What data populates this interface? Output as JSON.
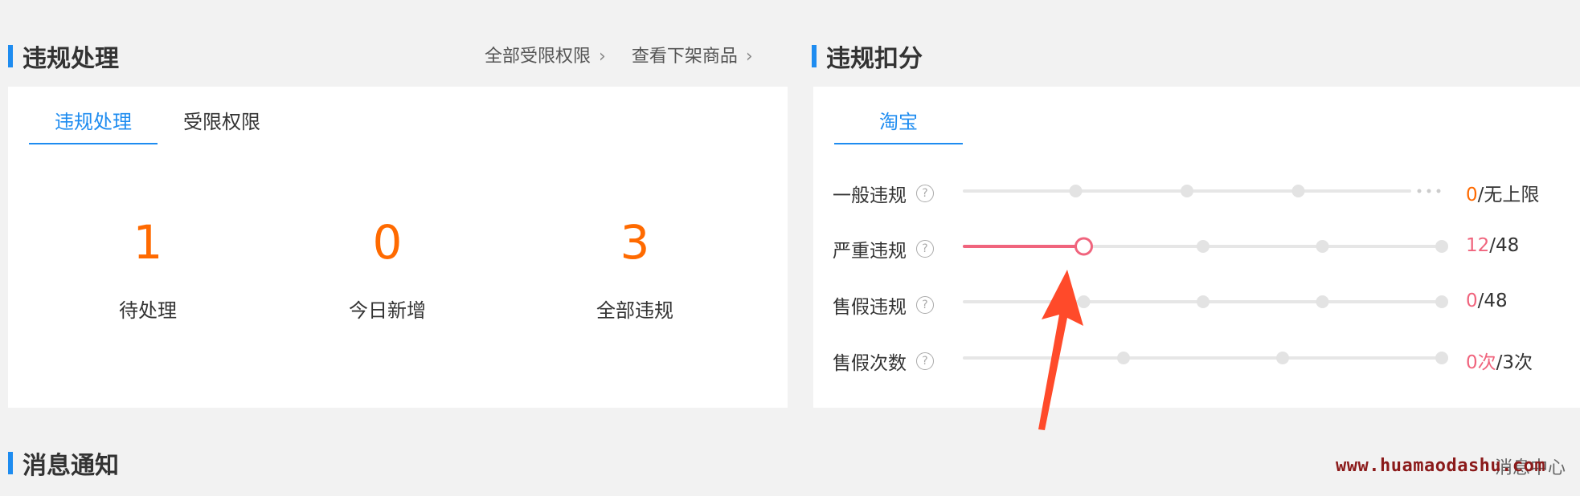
{
  "violation_section": {
    "title": "违规处理",
    "links": [
      "全部受限权限",
      "查看下架商品"
    ],
    "tabs": [
      {
        "label": "违规处理",
        "active": true
      },
      {
        "label": "受限权限",
        "active": false
      }
    ],
    "stats": [
      {
        "value": "1",
        "label": "待处理"
      },
      {
        "value": "0",
        "label": "今日新增"
      },
      {
        "value": "3",
        "label": "全部违规"
      }
    ]
  },
  "deduction_section": {
    "title": "违规扣分",
    "tabs": [
      {
        "label": "淘宝",
        "active": true
      }
    ],
    "rows": [
      {
        "label": "一般违规",
        "current": "0",
        "sep": "/",
        "limit": "无上限",
        "progress": 0,
        "unlimited": true,
        "ticks": 3
      },
      {
        "label": "严重违规",
        "current": "12",
        "sep": "/",
        "limit": "48",
        "progress": 0.25,
        "unlimited": false,
        "ticks": 3
      },
      {
        "label": "售假违规",
        "current": "0",
        "sep": "/",
        "limit": "48",
        "progress": 0,
        "unlimited": false,
        "ticks": 3
      },
      {
        "label": "售假次数",
        "current": "0次",
        "sep": "/",
        "limit": "3次",
        "progress": 0,
        "unlimited": false,
        "ticks": 2
      }
    ]
  },
  "message_section": {
    "title": "消息通知",
    "link": "消息中心"
  },
  "watermark": "www.huamaodashu.com",
  "colors": {
    "accent_blue": "#1e8cf0",
    "stat_orange": "#ff6a00",
    "progress_pink": "#f0647d",
    "arrow_red": "#ff4a2a"
  },
  "icons": {
    "help": "question-circle-icon",
    "chevron": "chevron-right-icon",
    "arrow": "annotation-arrow-icon"
  }
}
